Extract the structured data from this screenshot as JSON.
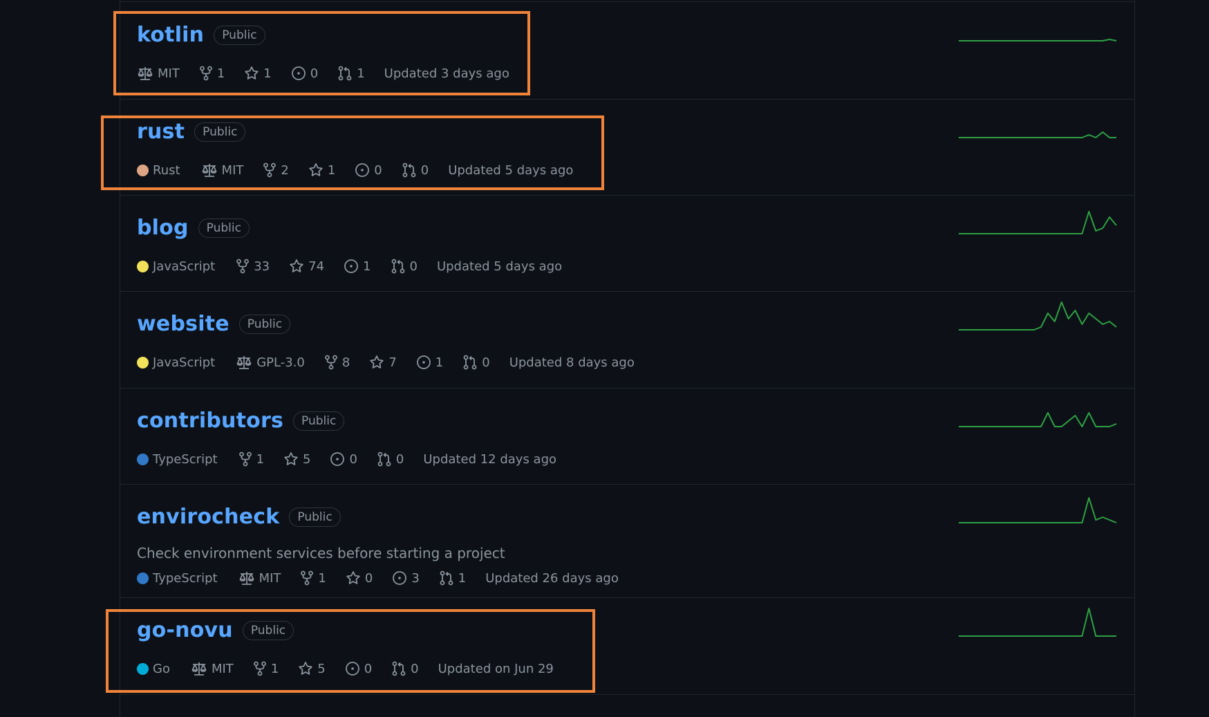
{
  "colors": {
    "link": "#58a6ff",
    "background": "#0d1117",
    "highlight": "#f0833a",
    "spark": "#2ea043",
    "lang_rust": "#dea584",
    "lang_javascript": "#f1e05a",
    "lang_typescript": "#3178c6",
    "lang_go": "#00add8"
  },
  "repos": [
    {
      "name": "kotlin",
      "visibility": "Public",
      "description": "",
      "language": "",
      "license": "MIT",
      "forks": "1",
      "stars": "1",
      "issues": "0",
      "pulls": "1",
      "updated": "Updated 3 days ago",
      "activity": [
        0,
        0,
        0,
        0,
        0,
        0,
        0,
        0,
        0,
        0,
        0,
        0,
        0,
        0,
        0,
        0,
        0,
        0,
        0,
        0,
        0,
        0,
        0.05,
        0
      ]
    },
    {
      "name": "rust",
      "visibility": "Public",
      "description": "",
      "language": "Rust",
      "language_color": "#dea584",
      "license": "MIT",
      "forks": "2",
      "stars": "1",
      "issues": "0",
      "pulls": "0",
      "updated": "Updated 5 days ago",
      "activity": [
        0,
        0,
        0,
        0,
        0,
        0,
        0,
        0,
        0,
        0,
        0,
        0,
        0,
        0,
        0,
        0,
        0,
        0,
        0,
        0.1,
        0,
        0.2,
        0,
        0
      ]
    },
    {
      "name": "blog",
      "visibility": "Public",
      "description": "",
      "language": "JavaScript",
      "language_color": "#f1e05a",
      "license": "",
      "forks": "33",
      "stars": "74",
      "issues": "1",
      "pulls": "0",
      "updated": "Updated 5 days ago",
      "activity": [
        0,
        0,
        0,
        0,
        0,
        0,
        0,
        0,
        0,
        0,
        0,
        0,
        0,
        0,
        0,
        0,
        0,
        0,
        0,
        0.8,
        0.1,
        0.2,
        0.6,
        0.3
      ]
    },
    {
      "name": "website",
      "visibility": "Public",
      "description": "",
      "language": "JavaScript",
      "language_color": "#f1e05a",
      "license": "GPL-3.0",
      "forks": "8",
      "stars": "7",
      "issues": "1",
      "pulls": "0",
      "updated": "Updated 8 days ago",
      "activity": [
        0,
        0,
        0,
        0,
        0,
        0,
        0,
        0,
        0,
        0,
        0,
        0,
        0.1,
        0.6,
        0.3,
        1.0,
        0.4,
        0.7,
        0.2,
        0.6,
        0.4,
        0.2,
        0.3,
        0.1
      ]
    },
    {
      "name": "contributors",
      "visibility": "Public",
      "description": "",
      "language": "TypeScript",
      "language_color": "#3178c6",
      "license": "",
      "forks": "1",
      "stars": "5",
      "issues": "0",
      "pulls": "0",
      "updated": "Updated 12 days ago",
      "activity": [
        0,
        0,
        0,
        0,
        0,
        0,
        0,
        0,
        0,
        0,
        0,
        0,
        0,
        0.5,
        0,
        0,
        0.2,
        0.4,
        0,
        0.5,
        0,
        0,
        0,
        0.1
      ]
    },
    {
      "name": "envirocheck",
      "visibility": "Public",
      "description": "Check environment services before starting a project",
      "language": "TypeScript",
      "language_color": "#3178c6",
      "license": "MIT",
      "forks": "1",
      "stars": "0",
      "issues": "3",
      "pulls": "1",
      "updated": "Updated 26 days ago",
      "activity": [
        0,
        0,
        0,
        0,
        0,
        0,
        0,
        0,
        0,
        0,
        0,
        0,
        0,
        0,
        0,
        0,
        0,
        0,
        0,
        0.9,
        0.1,
        0.2,
        0.1,
        0
      ]
    },
    {
      "name": "go-novu",
      "visibility": "Public",
      "description": "",
      "language": "Go",
      "language_color": "#00add8",
      "license": "MIT",
      "forks": "1",
      "stars": "5",
      "issues": "0",
      "pulls": "0",
      "updated": "Updated on Jun 29",
      "activity": [
        0,
        0,
        0,
        0,
        0,
        0,
        0,
        0,
        0,
        0,
        0,
        0,
        0,
        0,
        0,
        0,
        0,
        0,
        0,
        1.0,
        0,
        0,
        0,
        0
      ]
    }
  ]
}
